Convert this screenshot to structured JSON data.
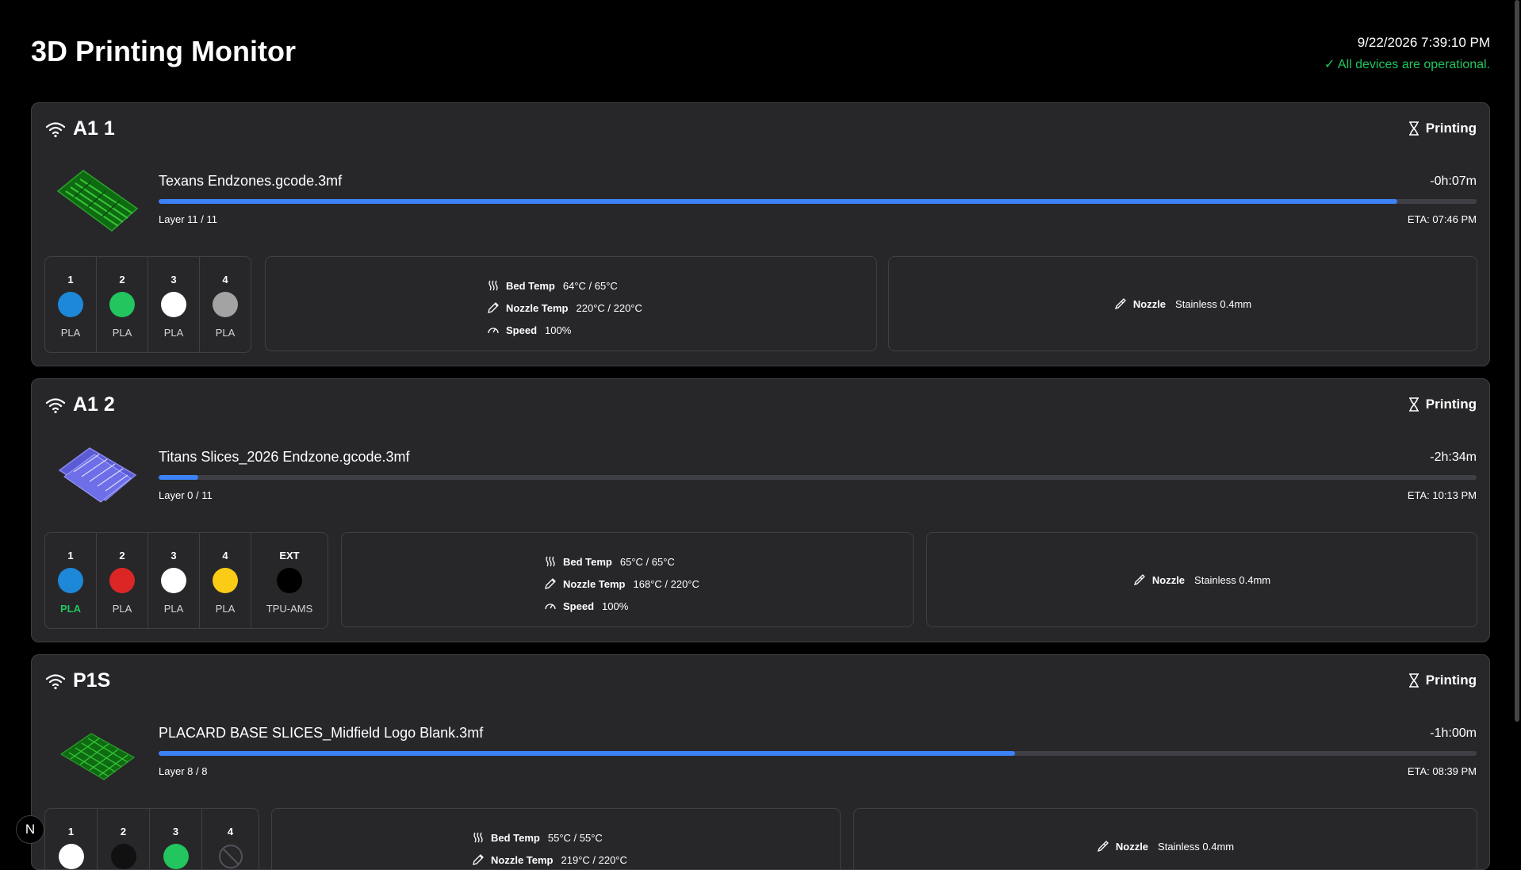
{
  "header": {
    "title": "3D Printing Monitor",
    "datetime": "9/22/2026 7:39:10 PM",
    "status": "✓ All devices are operational."
  },
  "printers": [
    {
      "name": "A1 1",
      "status": "Printing",
      "file": "Texans Endzones.gcode.3mf",
      "remaining": "-0h:07m",
      "progress": 94,
      "layer": "Layer 11 / 11",
      "eta": "ETA: 07:46 PM",
      "slots": [
        {
          "num": "1",
          "color": "#1e88d8",
          "material": "PLA"
        },
        {
          "num": "2",
          "color": "#22c55e",
          "material": "PLA"
        },
        {
          "num": "3",
          "color": "#ffffff",
          "material": "PLA"
        },
        {
          "num": "4",
          "color": "#a3a3a3",
          "material": "PLA"
        }
      ],
      "bed_label": "Bed Temp",
      "bed": "64°C / 65°C",
      "nozzle_temp_label": "Nozzle Temp",
      "nozzle_temp": "220°C / 220°C",
      "speed_label": "Speed",
      "speed": "100%",
      "nozzle_label": "Nozzle",
      "nozzle": "Stainless 0.4mm"
    },
    {
      "name": "A1 2",
      "status": "Printing",
      "file": "Titans Slices_2026 Endzone.gcode.3mf",
      "remaining": "-2h:34m",
      "progress": 3,
      "layer": "Layer 0 / 11",
      "eta": "ETA: 10:13 PM",
      "slots": [
        {
          "num": "1",
          "color": "#1e88d8",
          "material": "PLA",
          "active": true
        },
        {
          "num": "2",
          "color": "#dc2626",
          "material": "PLA"
        },
        {
          "num": "3",
          "color": "#ffffff",
          "material": "PLA"
        },
        {
          "num": "4",
          "color": "#facc15",
          "material": "PLA"
        },
        {
          "num": "EXT",
          "color": "#000000",
          "material": "TPU-AMS"
        }
      ],
      "bed_label": "Bed Temp",
      "bed": "65°C / 65°C",
      "nozzle_temp_label": "Nozzle Temp",
      "nozzle_temp": "168°C / 220°C",
      "speed_label": "Speed",
      "speed": "100%",
      "nozzle_label": "Nozzle",
      "nozzle": "Stainless 0.4mm"
    },
    {
      "name": "P1S",
      "status": "Printing",
      "file": "PLACARD BASE SLICES_Midfield Logo Blank.3mf",
      "remaining": "-1h:00m",
      "progress": 65,
      "layer": "Layer 8 / 8",
      "eta": "ETA: 08:39 PM",
      "slots": [
        {
          "num": "1",
          "color": "#ffffff"
        },
        {
          "num": "2",
          "color": "#111111"
        },
        {
          "num": "3",
          "color": "#22c55e"
        },
        {
          "num": "4",
          "color": "",
          "empty": true
        }
      ],
      "bed_label": "Bed Temp",
      "bed": "55°C / 55°C",
      "nozzle_temp_label": "Nozzle Temp",
      "nozzle_temp": "219°C / 220°C",
      "nozzle_label": "Nozzle",
      "nozzle": "Stainless 0.4mm"
    }
  ],
  "badge": "N"
}
